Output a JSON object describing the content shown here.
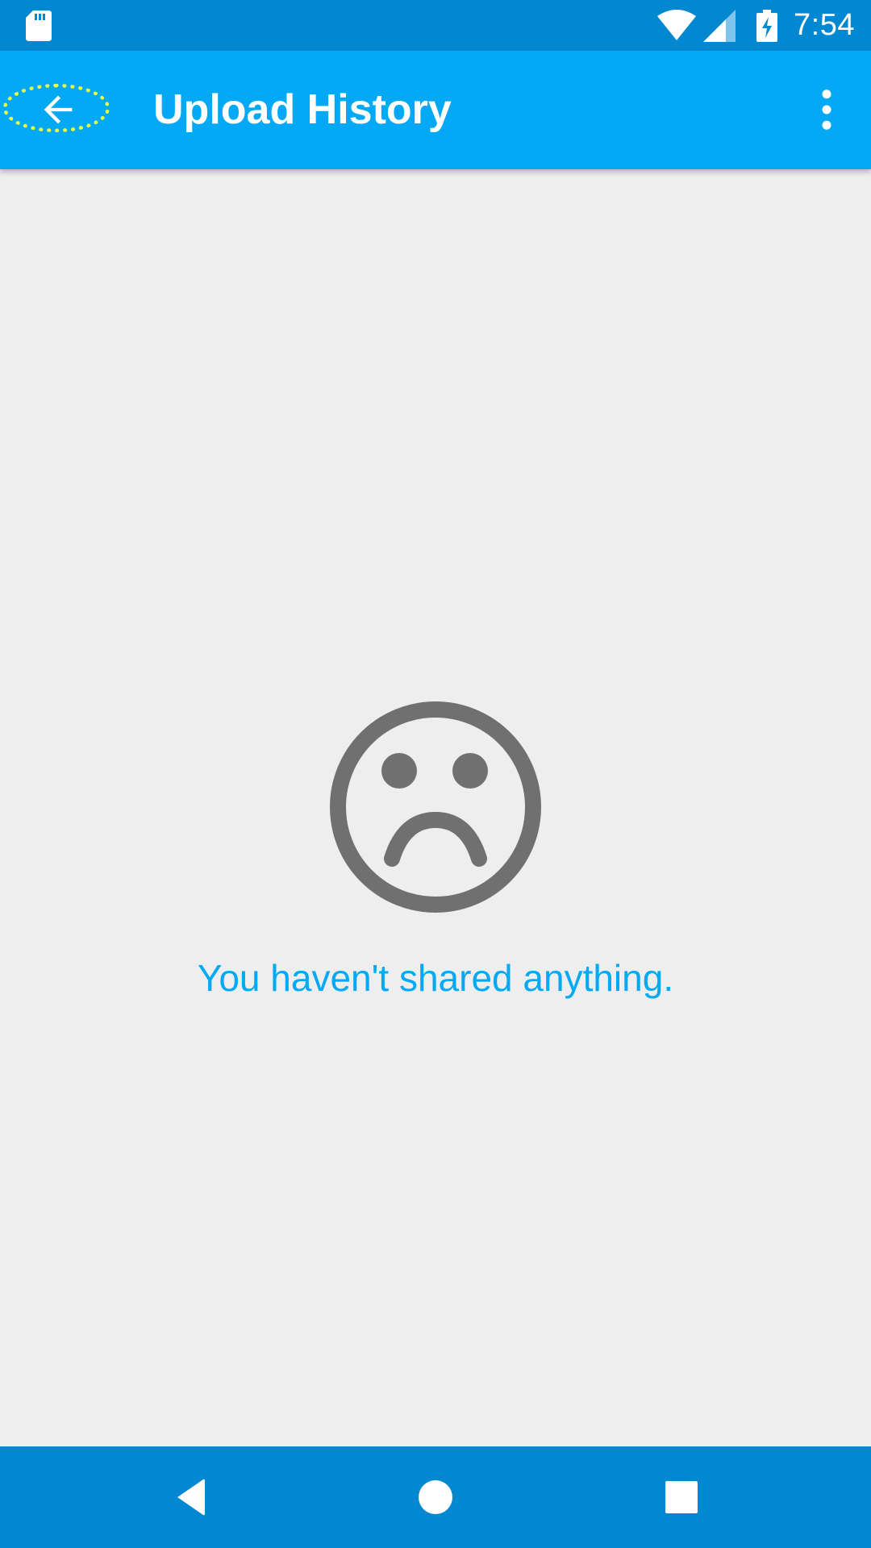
{
  "status_bar": {
    "time": "7:54",
    "icons": [
      "sd-card-icon",
      "wifi-icon",
      "cell-signal-icon",
      "battery-charging-icon"
    ]
  },
  "toolbar": {
    "title": "Upload History",
    "back_icon": "arrow-back-icon",
    "overflow_icon": "more-vert-icon"
  },
  "empty_state": {
    "icon": "sad-face-icon",
    "message": "You haven't shared anything."
  },
  "nav_bar": {
    "buttons": [
      "back-triangle-icon",
      "home-circle-icon",
      "recents-square-icon"
    ]
  },
  "colors": {
    "status_bar": "#0288d1",
    "toolbar": "#03a9f4",
    "background": "#eeeeee",
    "accent_text": "#03a9f4",
    "icon_gray": "#707070",
    "focus_highlight": "#eeff41"
  }
}
